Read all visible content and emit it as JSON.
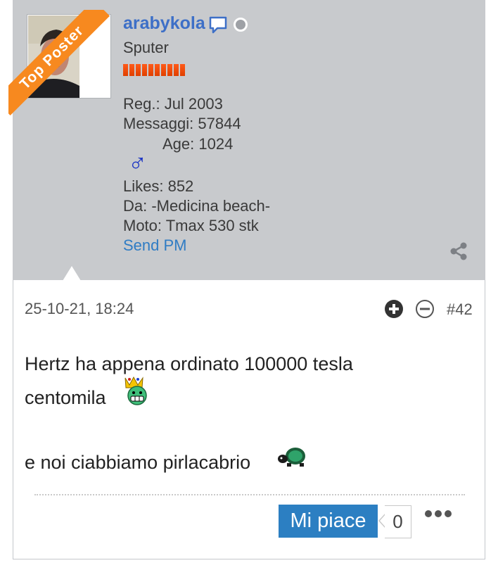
{
  "user": {
    "ribbon": "Top Poster",
    "username": "arabykola",
    "rank": "Sputer",
    "rank_bar_segments": 10,
    "registered": "Reg.: Jul 2003",
    "messages": "Messaggi: 57844",
    "age": "Age: 1024",
    "gender_symbol": "♂",
    "likes": "Likes: 852",
    "location": "Da: -Medicina beach-",
    "moto": "Moto: Tmax 530 stk",
    "send_pm": "Send PM"
  },
  "post": {
    "date": "25-10-21, 18:24",
    "number": "#42",
    "line1": "Hertz ha appena ordinato 100000 tesla",
    "line2": "centomila",
    "line3": "e noi ciabbiamo pirlacabrio"
  },
  "actions": {
    "like_label": "Mi piace",
    "like_count": "0"
  },
  "colors": {
    "username": "#3d6fc7",
    "ribbon": "#f7891f",
    "like_button": "#2c7fc2",
    "userbar_bg": "#c8cacd"
  }
}
